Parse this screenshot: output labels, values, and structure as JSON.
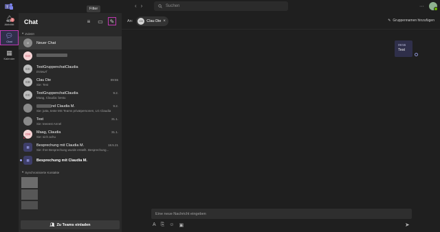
{
  "topbar": {
    "search_placeholder": "Suchen"
  },
  "appbar": {
    "items": [
      {
        "label": "Aktivität",
        "icon": "bell-icon"
      },
      {
        "label": "Chat",
        "icon": "chat-icon",
        "active": true,
        "badge": "2"
      },
      {
        "label": "Kalender",
        "icon": "calendar-icon"
      }
    ]
  },
  "chatlist": {
    "title": "Chat",
    "tooltip": "Filter",
    "recent_label": "Zuletzt",
    "contacts_label": "Synchronisierte Kontakte",
    "invite_label": "Zu Teams einladen",
    "rows": [
      {
        "name": "Neuer Chat",
        "sub": "",
        "time": "",
        "avatar": "",
        "kind": "new"
      },
      {
        "name": "",
        "sub": "",
        "time": "",
        "avatar": "CO",
        "kind": "blurred"
      },
      {
        "name": "TestGruppenchatClaudia",
        "sub": "Entwurf",
        "time": "",
        "avatar": "CC",
        "kind": "group"
      },
      {
        "name": "Clau Die",
        "sub": "Sie: Test",
        "time": "09:55",
        "avatar": "CD",
        "kind": "person"
      },
      {
        "name": "TestGruppenchatClaudia",
        "sub": "Maag, Claudia: bestu",
        "time": "9.2.",
        "avatar": "CC",
        "kind": "group"
      },
      {
        "name": "nd Claudia M.",
        "sub": "Sie: jutta, teste MS Teams privatpersonen, LG Claudia",
        "time": "9.2.",
        "avatar": "",
        "kind": "group-blur"
      },
      {
        "name": "Test",
        "sub": "Sie: teeeest Annel",
        "time": "31.1.",
        "avatar": "",
        "kind": "photo"
      },
      {
        "name": "Maag, Claudia",
        "sub": "Sie: sich achu",
        "time": "31.1.",
        "avatar": "CM",
        "kind": "red"
      },
      {
        "name": "Besprechung mit Claudia M.",
        "sub": "Sie: Ihre Besprechung wurde erstellt. Besprechung...",
        "time": "18.5.21",
        "avatar": "",
        "kind": "meeting"
      },
      {
        "name": "Besprechung mit Claudia M.",
        "sub": "",
        "time": "",
        "avatar": "",
        "kind": "meeting-bold"
      }
    ]
  },
  "main": {
    "to_label": "An:",
    "recipient": {
      "initials": "CD",
      "name": "Clau Die"
    },
    "add_group_label": "Gruppennamen hinzufügen",
    "message": {
      "time": "09:55",
      "text": "Test"
    },
    "compose_placeholder": "Eine neue Nachricht eingeben"
  },
  "colors": {
    "accent": "#c239b3",
    "brand": "#6264a7",
    "background": "#1f1f1f",
    "panel": "#292929"
  }
}
